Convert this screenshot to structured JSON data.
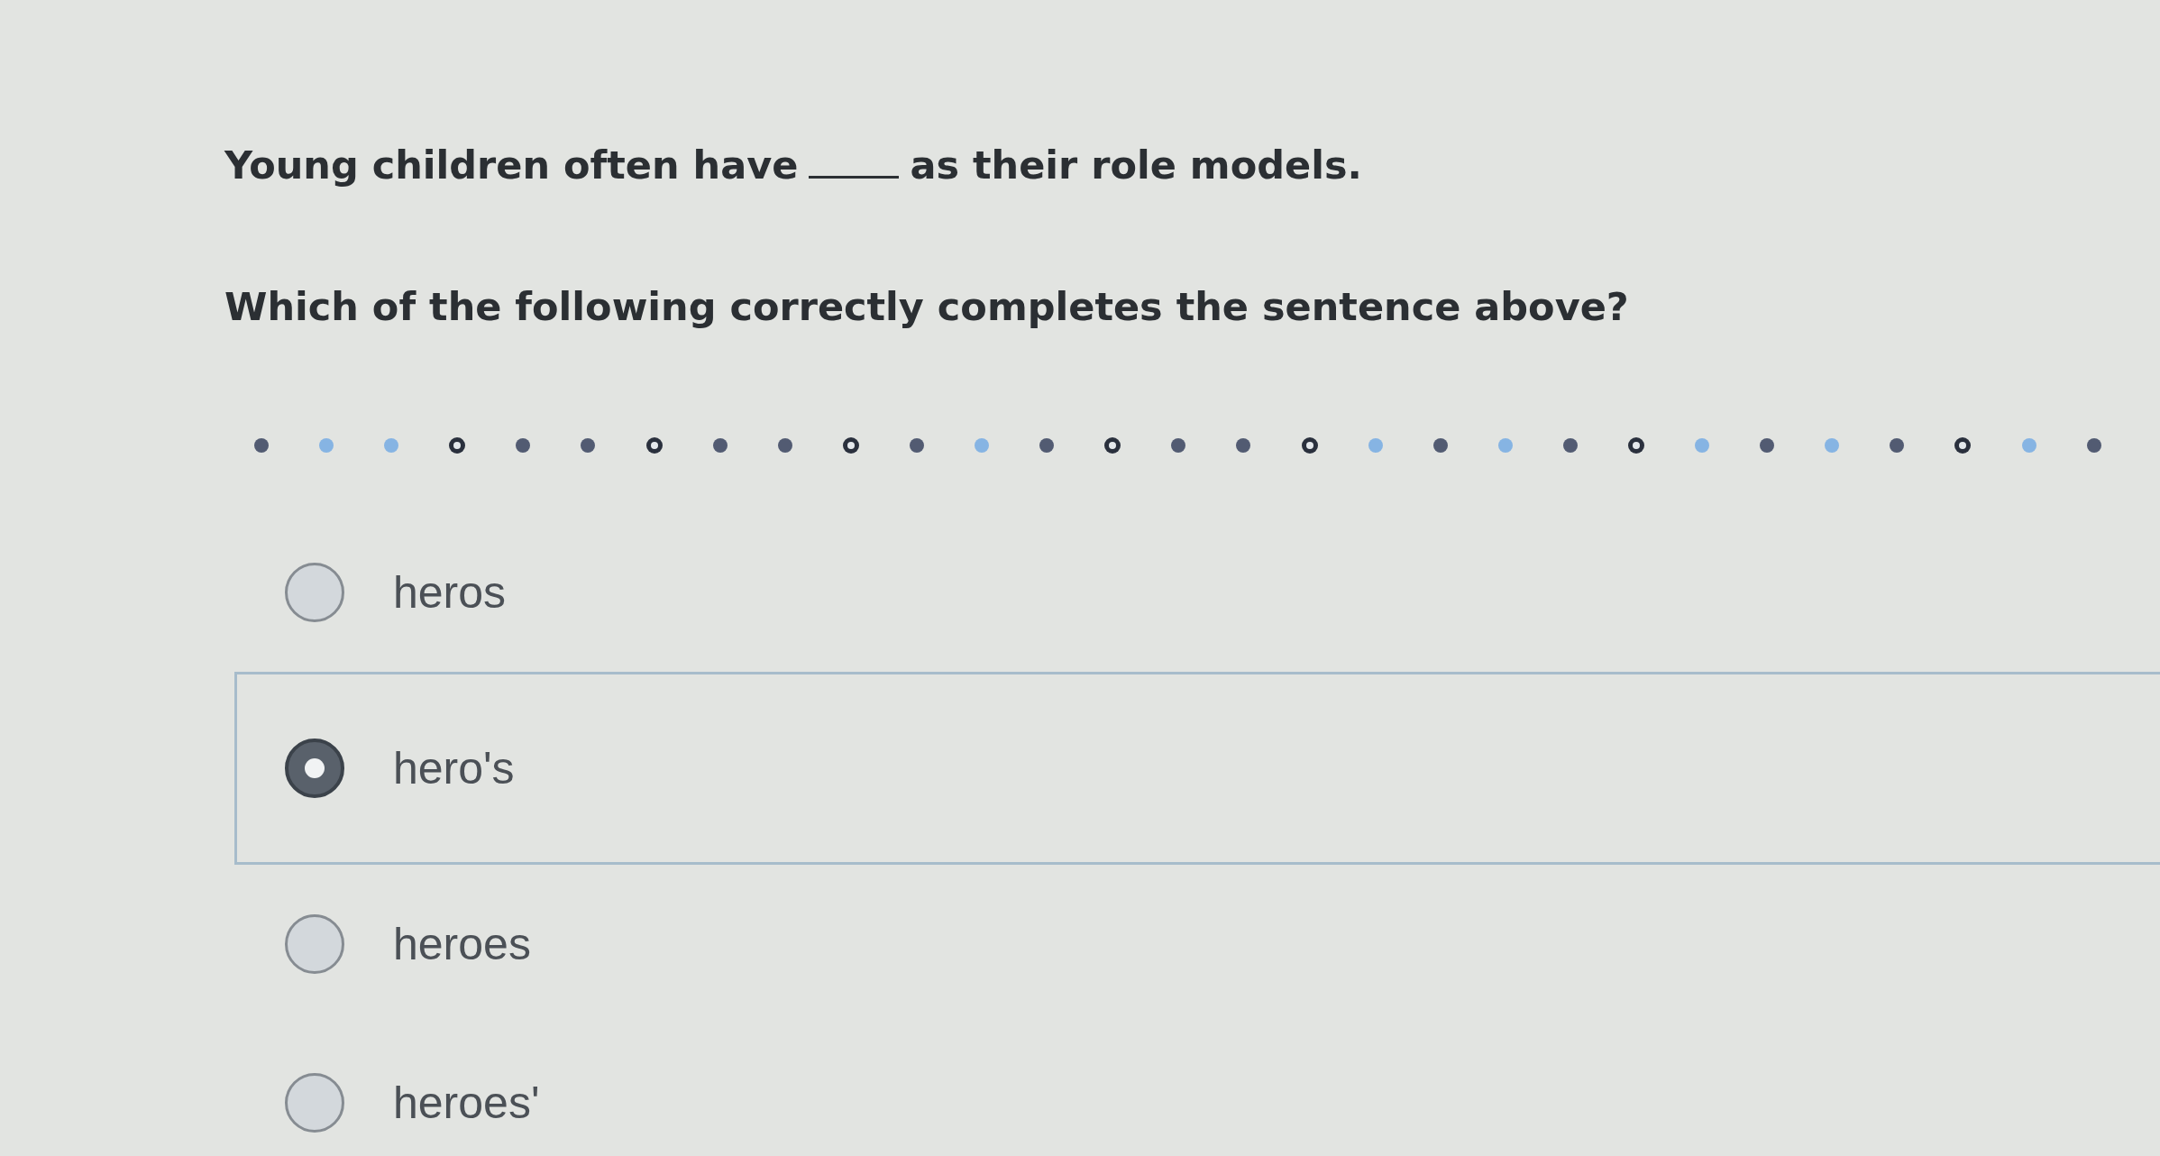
{
  "question": {
    "sentence": {
      "before": "Young children often have",
      "after": "as their role models."
    },
    "prompt": "Which of the following correctly completes the sentence above?"
  },
  "divider": {
    "dots": [
      {
        "kind": "filled"
      },
      {
        "kind": "pale"
      },
      {
        "kind": "pale"
      },
      {
        "kind": "ring"
      },
      {
        "kind": "filled"
      },
      {
        "kind": "filled"
      },
      {
        "kind": "ring"
      },
      {
        "kind": "filled"
      },
      {
        "kind": "filled"
      },
      {
        "kind": "ring"
      },
      {
        "kind": "filled"
      },
      {
        "kind": "pale"
      },
      {
        "kind": "filled"
      },
      {
        "kind": "ring"
      },
      {
        "kind": "filled"
      },
      {
        "kind": "filled"
      },
      {
        "kind": "ring"
      },
      {
        "kind": "pale"
      },
      {
        "kind": "filled"
      },
      {
        "kind": "pale"
      },
      {
        "kind": "filled"
      },
      {
        "kind": "ring"
      },
      {
        "kind": "pale"
      },
      {
        "kind": "filled"
      },
      {
        "kind": "pale"
      },
      {
        "kind": "filled"
      },
      {
        "kind": "ring"
      },
      {
        "kind": "pale"
      },
      {
        "kind": "filled"
      }
    ]
  },
  "options": [
    {
      "label": "heros",
      "selected": false
    },
    {
      "label": "hero's",
      "selected": true
    },
    {
      "label": "heroes",
      "selected": false
    },
    {
      "label": "heroes'",
      "selected": false
    }
  ]
}
